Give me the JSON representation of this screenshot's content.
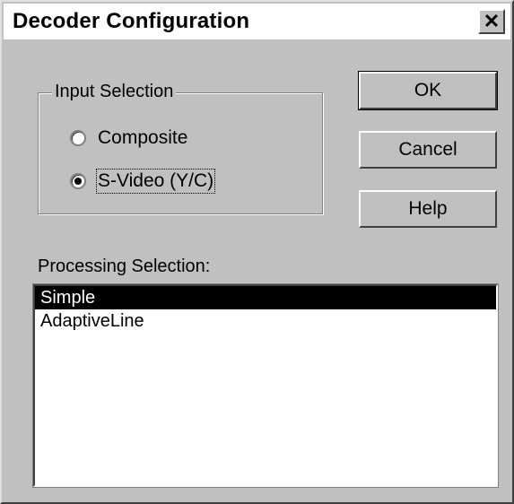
{
  "window": {
    "title": "Decoder Configuration",
    "close_glyph": "✕"
  },
  "input_selection": {
    "label": "Input Selection",
    "options": [
      {
        "label": "Composite",
        "checked": false
      },
      {
        "label": "S-Video (Y/C)",
        "checked": true
      }
    ]
  },
  "buttons": {
    "ok": "OK",
    "cancel": "Cancel",
    "help": "Help"
  },
  "processing_selection": {
    "label": "Processing Selection:",
    "items": [
      {
        "label": "Simple",
        "selected": true
      },
      {
        "label": "AdaptiveLine",
        "selected": false
      }
    ]
  }
}
